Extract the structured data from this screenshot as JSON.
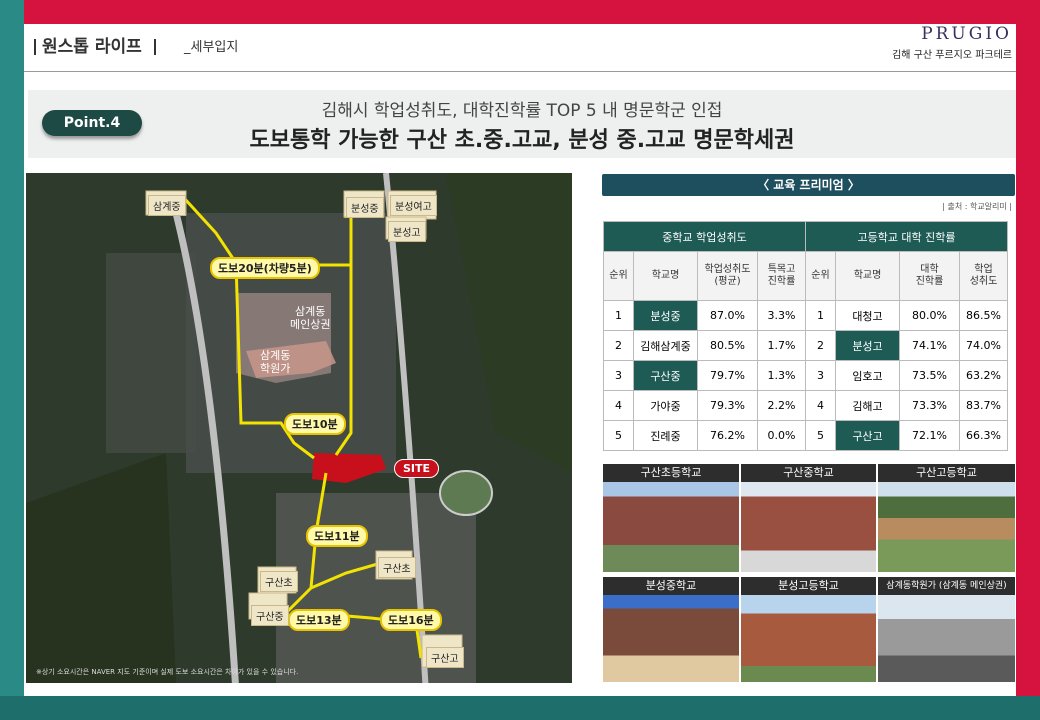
{
  "header": {
    "title": "원스톱 라이프",
    "subtitle": "_세부입지",
    "brand_logo": "PRUGIO",
    "brand_name": "김해 구산 푸르지오 파크테르"
  },
  "banner": {
    "badge": "Point.4",
    "subtitle": "김해시 학업성취도, 대학진학률 TOP 5 내 명문학군 인접",
    "title": "도보통학 가능한 구산 초.중.고교, 분성 중.고교 명문학세권"
  },
  "map": {
    "route_labels": [
      "도보20분(차량5분)",
      "도보10분",
      "도보11분",
      "도보13분",
      "도보16분"
    ],
    "school_labels": [
      "삼계중",
      "분성중",
      "분성여고",
      "분성고",
      "구산초",
      "구산중",
      "구산초",
      "구산고"
    ],
    "area_labels": [
      "삼계동\n메인상권",
      "삼계동\n학원가"
    ],
    "site": "SITE",
    "note": "※상기 소요시간은 NAVER 지도 기준이며 실제 도보 소요시간은 차이가 있을 수 있습니다."
  },
  "education": {
    "header": "〈 교육 프리미엄 〉",
    "source": "| 출처 : 학교알리미 |",
    "middle_group": "중학교 학업성취도",
    "high_group": "고등학교 대학 진학률",
    "middle_headers": [
      "순위",
      "학교명",
      "학업성취도\n(평균)",
      "특목고\n진학률"
    ],
    "high_headers": [
      "순위",
      "학교명",
      "대학\n진학률",
      "학업\n성취도"
    ],
    "middle_rows": [
      {
        "rank": "1",
        "name": "분성중",
        "score": "87.0%",
        "special": "3.3%",
        "hl": true
      },
      {
        "rank": "2",
        "name": "김해삼계중",
        "score": "80.5%",
        "special": "1.7%",
        "hl": false
      },
      {
        "rank": "3",
        "name": "구산중",
        "score": "79.7%",
        "special": "1.3%",
        "hl": true
      },
      {
        "rank": "4",
        "name": "가야중",
        "score": "79.3%",
        "special": "2.2%",
        "hl": false
      },
      {
        "rank": "5",
        "name": "진례중",
        "score": "76.2%",
        "special": "0.0%",
        "hl": false
      }
    ],
    "high_rows": [
      {
        "rank": "1",
        "name": "대청고",
        "college": "80.0%",
        "achievement": "86.5%",
        "hl": false
      },
      {
        "rank": "2",
        "name": "분성고",
        "college": "74.1%",
        "achievement": "74.0%",
        "hl": true
      },
      {
        "rank": "3",
        "name": "임호고",
        "college": "73.5%",
        "achievement": "63.2%",
        "hl": false
      },
      {
        "rank": "4",
        "name": "김해고",
        "college": "73.3%",
        "achievement": "83.7%",
        "hl": false
      },
      {
        "rank": "5",
        "name": "구산고",
        "college": "72.1%",
        "achievement": "66.3%",
        "hl": true
      }
    ]
  },
  "photos": [
    "구산초등학교",
    "구산중학교",
    "구산고등학교",
    "분성중학교",
    "분성고등학교",
    "삼계동학원가 (삼계동 메인상권)"
  ],
  "colors": {
    "frame_red": "#d6123e",
    "frame_teal": "#2a8a86",
    "accent_green": "#1e5b55",
    "route_yellow": "#f2e300",
    "site_red": "#c8101c"
  }
}
